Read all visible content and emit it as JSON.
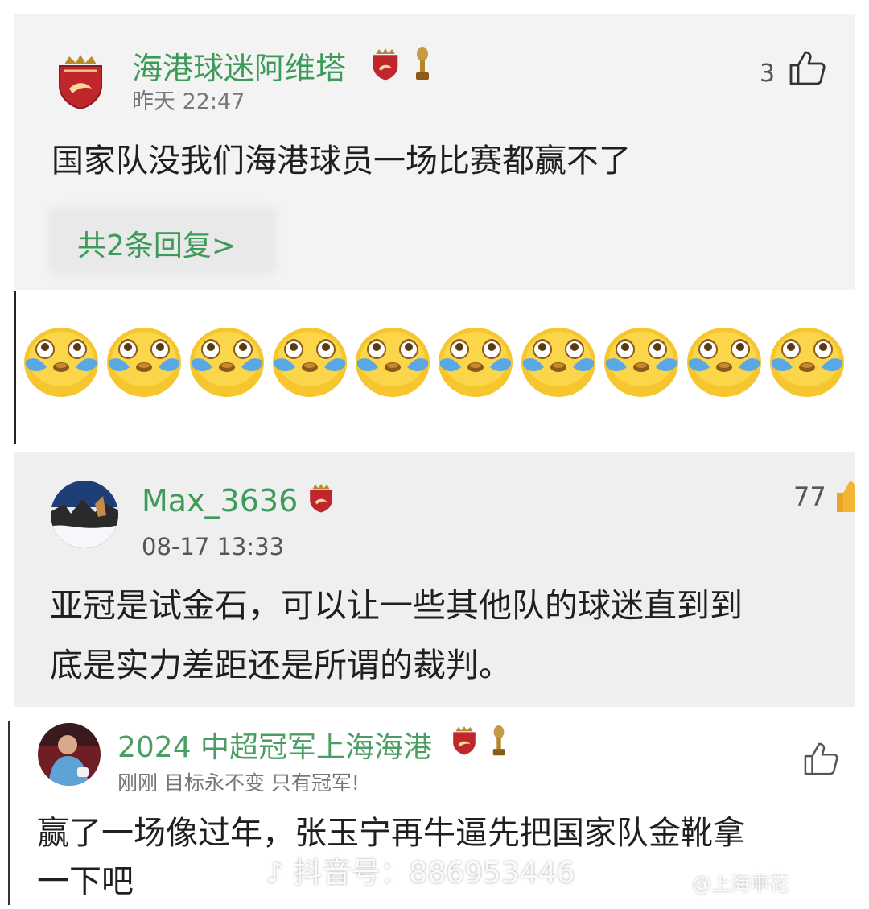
{
  "comments": [
    {
      "username": "海港球迷阿维塔",
      "time": "昨天 22:47",
      "text": "国家队没我们海港球员一场比赛都赢不了",
      "likes": "3",
      "reply_label": "共2条回复>",
      "username_color": "#3d9b5a"
    },
    {
      "username": "Max_3636",
      "time": "08-17 13:33",
      "text_line1": "亚冠是试金石，可以让一些其他队的球迷直到到",
      "text_line2": "底是实力差距还是所谓的裁判。",
      "likes": "77",
      "username_color": "#3d9b5a"
    },
    {
      "username": "2024 中超冠军上海海港",
      "time": "刚刚 目标永不变 只有冠军!",
      "text_line1": "赢了一场像过年，张玉宁再牛逼先把国家队金靴拿",
      "text_line2": "一下吧",
      "username_color": "#4a9d63"
    }
  ],
  "emoji_row": {
    "emoji_name": "crying-laughing-emoji",
    "count": 10
  },
  "watermark": {
    "text": "抖音号：886953446",
    "corner_text": "@上海申花"
  },
  "colors": {
    "accent_green": "#3d9b5a",
    "badge_red": "#c0272d",
    "trophy_gold": "#b8862a"
  }
}
